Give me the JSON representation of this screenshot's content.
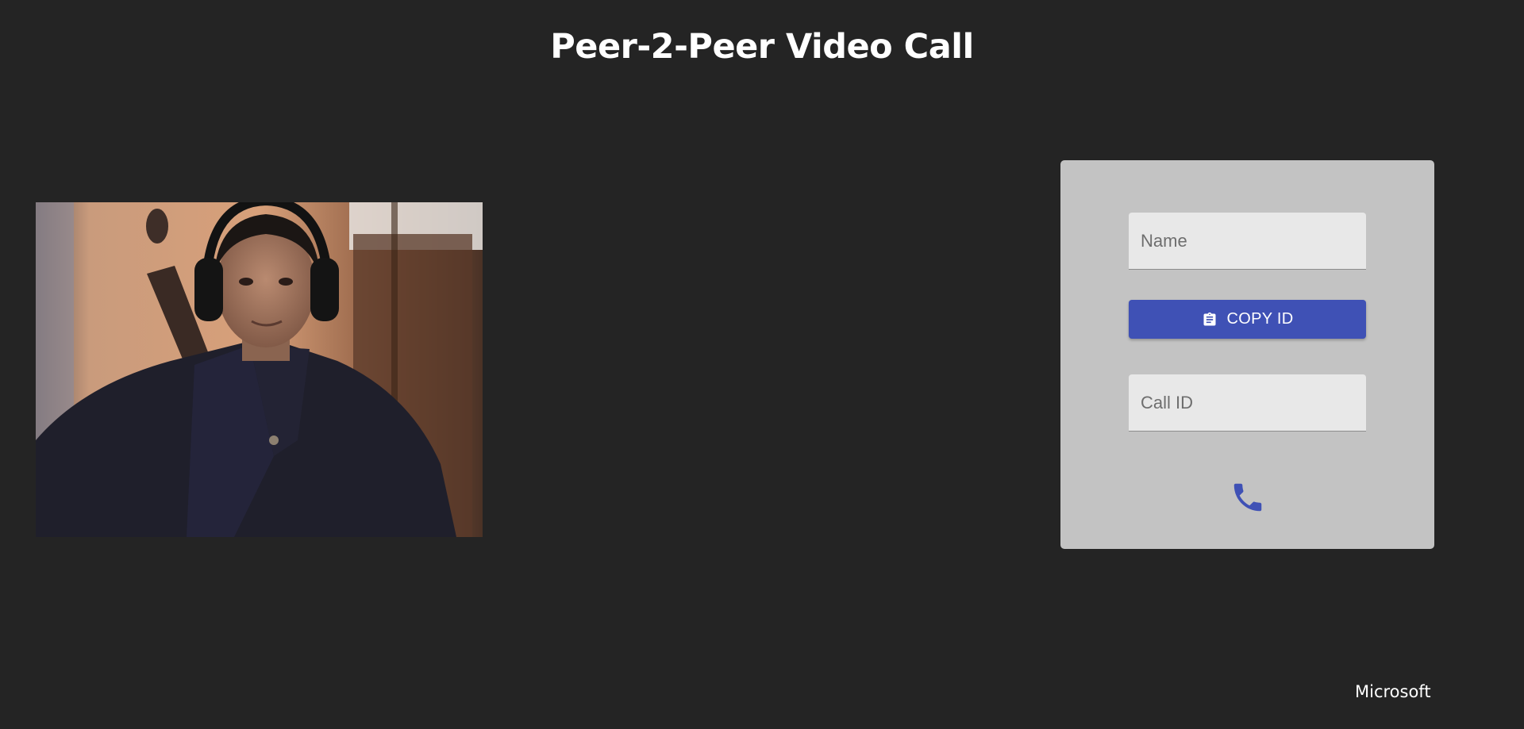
{
  "header": {
    "title": "Peer-2-Peer Video Call"
  },
  "video": {
    "icon": "webcam-feed"
  },
  "panel": {
    "name_placeholder": "Name",
    "name_value": "",
    "copy_button_label": "COPY ID",
    "copy_icon": "clipboard-icon",
    "call_id_placeholder": "Call ID",
    "call_id_value": "",
    "call_icon": "phone-icon"
  },
  "footer": {
    "brand": "Microsoft"
  },
  "colors": {
    "background": "#242424",
    "panel": "#c3c3c3",
    "accent": "#3f51b5",
    "field": "#e8e8e8"
  }
}
